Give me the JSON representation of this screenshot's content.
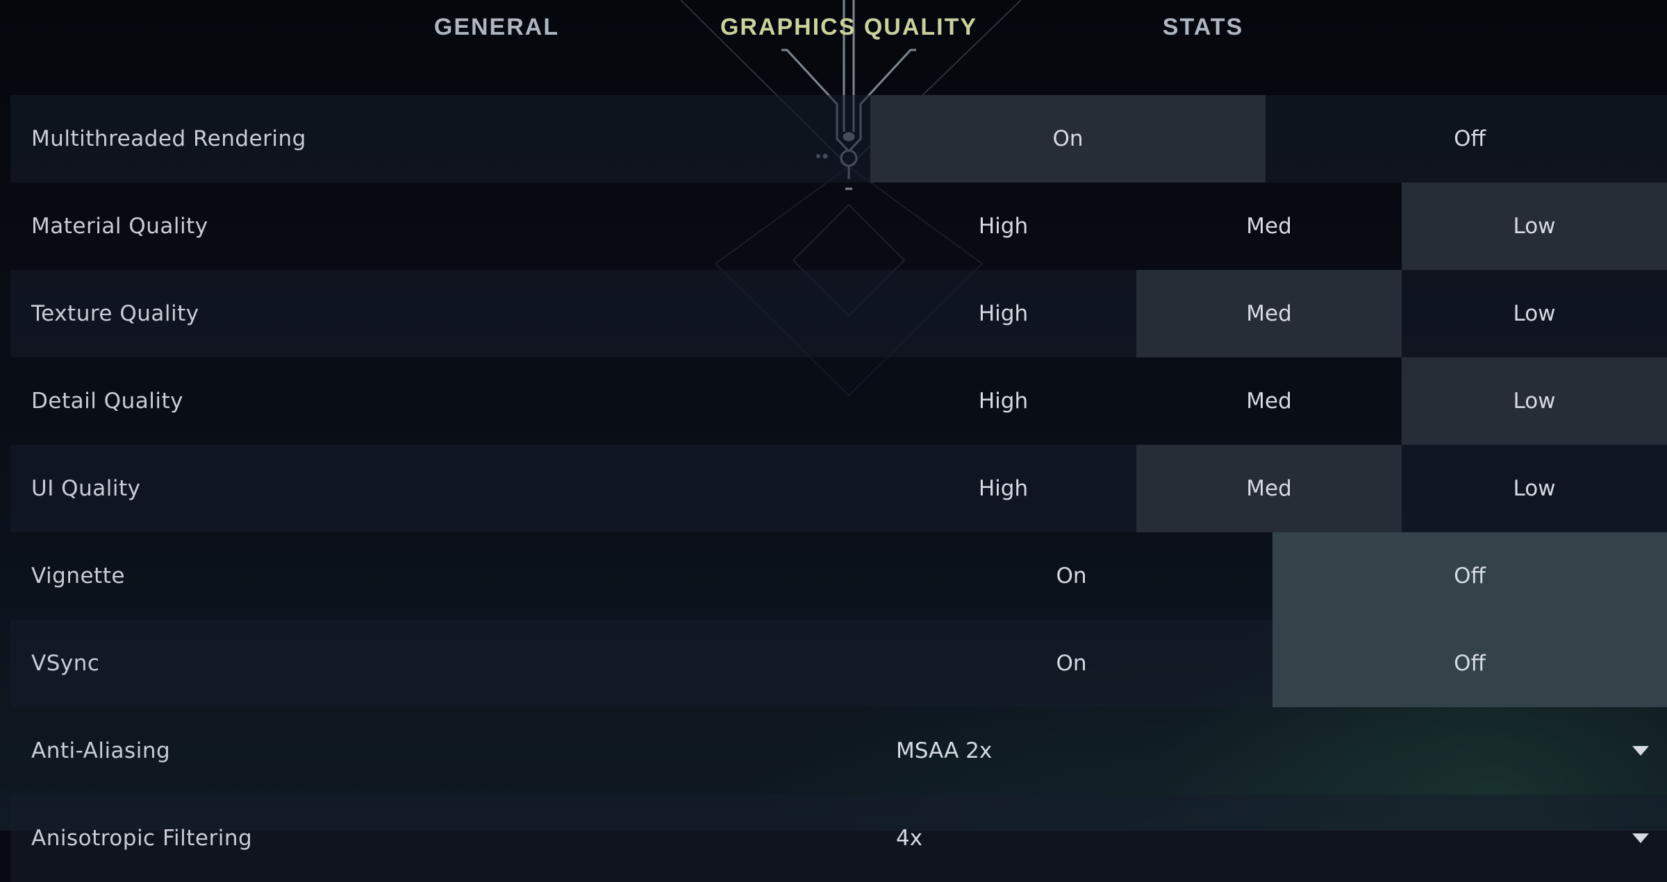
{
  "tabs": [
    {
      "label": "GENERAL",
      "active": false
    },
    {
      "label": "GRAPHICS QUALITY",
      "active": true
    },
    {
      "label": "STATS",
      "active": false
    }
  ],
  "settings": [
    {
      "label": "Multithreaded Rendering",
      "type": "toggle",
      "options": [
        "On",
        "Off"
      ],
      "selected": "On"
    },
    {
      "label": "Material Quality",
      "type": "choice",
      "options": [
        "High",
        "Med",
        "Low"
      ],
      "selected": "Low"
    },
    {
      "label": "Texture Quality",
      "type": "choice",
      "options": [
        "High",
        "Med",
        "Low"
      ],
      "selected": "Med"
    },
    {
      "label": "Detail Quality",
      "type": "choice",
      "options": [
        "High",
        "Med",
        "Low"
      ],
      "selected": "Low"
    },
    {
      "label": "UI Quality",
      "type": "choice",
      "options": [
        "High",
        "Med",
        "Low"
      ],
      "selected": "Med"
    },
    {
      "label": "Vignette",
      "type": "toggle",
      "options": [
        "On",
        "Off"
      ],
      "selected": "Off"
    },
    {
      "label": "VSync",
      "type": "toggle",
      "options": [
        "On",
        "Off"
      ],
      "selected": "Off"
    },
    {
      "label": "Anti-Aliasing",
      "type": "dropdown",
      "value": "MSAA 2x",
      "icon": "chevron-down-icon"
    },
    {
      "label": "Anisotropic Filtering",
      "type": "dropdown",
      "value": "4x",
      "icon": "chevron-down-icon"
    }
  ],
  "colors": {
    "active_tab": "#cbd19c",
    "inactive_tab": "#aeb6c2",
    "selected_option": "#272d37",
    "background": "#070a12"
  }
}
